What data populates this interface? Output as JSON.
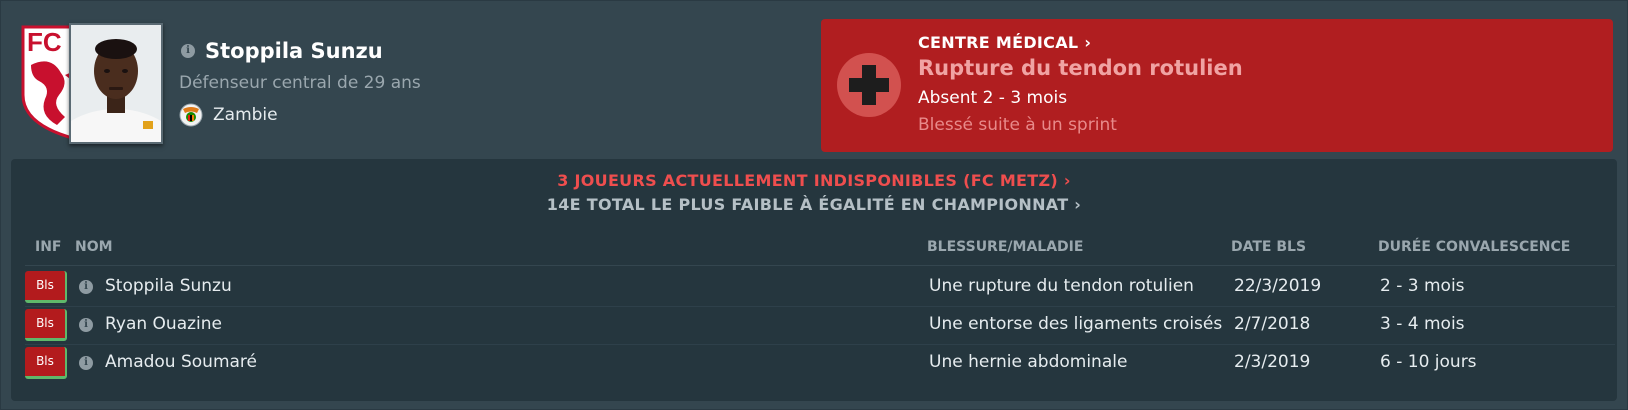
{
  "player": {
    "name": "Stoppila Sunzu",
    "description": "Défenseur central de 29 ans",
    "nationality": "Zambie",
    "club_badge_text": "FC M",
    "info_icon": "info-icon",
    "colors": {
      "club_red": "#c8102e"
    }
  },
  "medical": {
    "title": "CENTRE MÉDICAL",
    "chevron": "›",
    "injury": "Rupture du tendon rotulien",
    "absence": "Absent 2 - 3 mois",
    "cause": "Blessé suite à un sprint",
    "icon": "medical-cross-icon",
    "colors": {
      "panel": "#b01e20",
      "circle": "#d2514f"
    }
  },
  "summary": {
    "line1": "3 JOUEURS ACTUELLEMENT INDISPONIBLES (FC METZ) ›",
    "line2": "14E TOTAL LE PLUS FAIBLE À ÉGALITÉ EN CHAMPIONNAT ›"
  },
  "table": {
    "headers": {
      "inf": "INF",
      "name": "NOM",
      "injury": "BLESSURE/MALADIE",
      "date": "DATE BLS",
      "duration": "DURÉE CONVALESCENCE"
    },
    "rows": [
      {
        "badge": "Bls",
        "name": "Stoppila Sunzu",
        "injury": "Une rupture du tendon rotulien",
        "date": "22/3/2019",
        "duration": "2 - 3 mois"
      },
      {
        "badge": "Bls",
        "name": "Ryan Ouazine",
        "injury": "Une entorse des ligaments croisés",
        "date": "2/7/2018",
        "duration": "3 - 4 mois"
      },
      {
        "badge": "Bls",
        "name": "Amadou Soumaré",
        "injury": "Une hernie abdominale",
        "date": "2/3/2019",
        "duration": "6 - 10 jours"
      }
    ]
  }
}
